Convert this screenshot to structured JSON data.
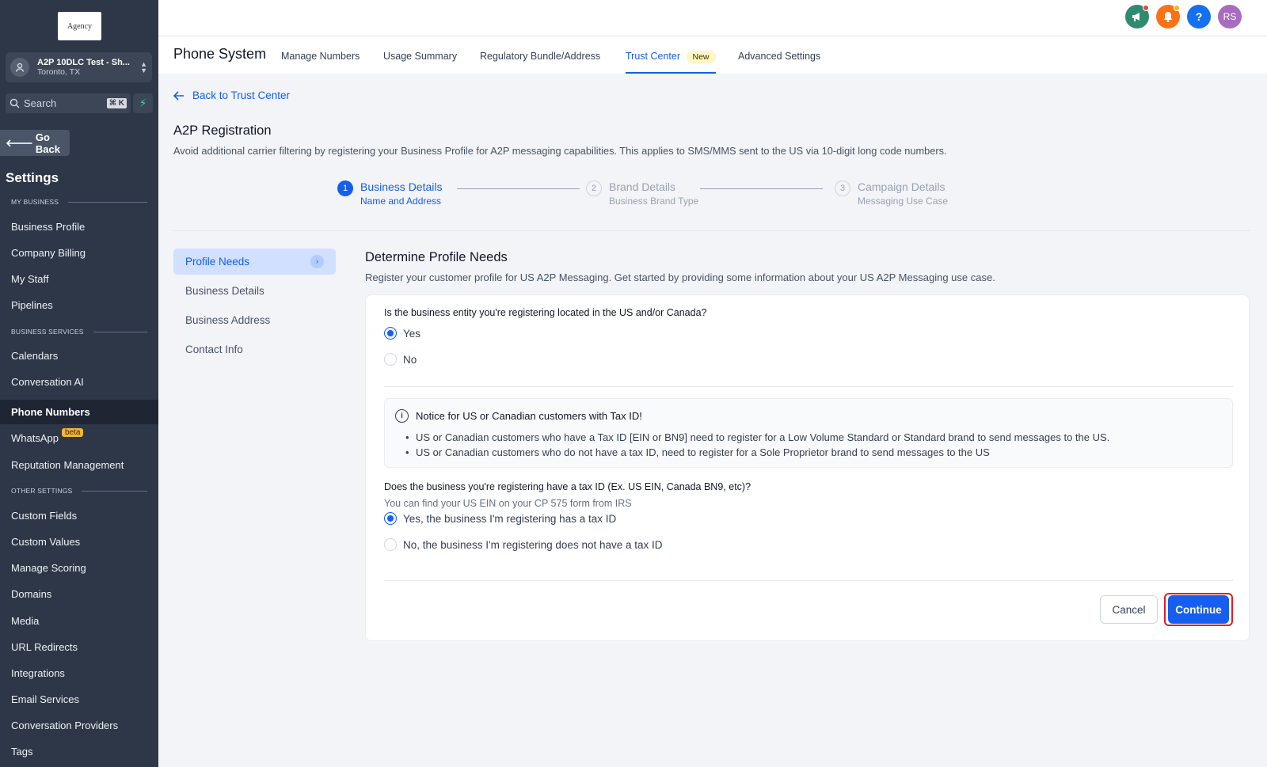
{
  "sidebar": {
    "logo_text": "Agency",
    "account": {
      "name": "A2P 10DLC Test - Sh...",
      "location": "Toronto, TX"
    },
    "search": {
      "placeholder": "Search",
      "shortcut": "⌘ K"
    },
    "go_back": "Go Back",
    "title": "Settings",
    "sections": [
      {
        "label": "MY BUSINESS",
        "items": [
          "Business Profile",
          "Company Billing",
          "My Staff",
          "Pipelines"
        ]
      },
      {
        "label": "BUSINESS SERVICES",
        "items": [
          "Calendars",
          "Conversation AI",
          "Phone Numbers",
          "WhatsApp",
          "Reputation Management"
        ]
      },
      {
        "label": "OTHER SETTINGS",
        "items": [
          "Custom Fields",
          "Custom Values",
          "Manage Scoring",
          "Domains",
          "Media",
          "URL Redirects",
          "Integrations",
          "Email Services",
          "Conversation Providers",
          "Tags"
        ]
      }
    ],
    "active_item": "Phone Numbers",
    "whatsapp_badge": "beta"
  },
  "header": {
    "avatar_initials": "RS",
    "icons": [
      "megaphone-icon",
      "bell-icon",
      "help-icon"
    ],
    "colors": {
      "megaphone": "#2e8b6f",
      "bell": "#f97316",
      "help": "#1570ef",
      "avatar": "#a86bbf"
    }
  },
  "tabs": {
    "app_title": "Phone System",
    "items": [
      "Manage Numbers",
      "Usage Summary",
      "Regulatory Bundle/Address",
      "Trust Center",
      "Advanced Settings"
    ],
    "active": "Trust Center",
    "new_badge": "New"
  },
  "page": {
    "back_link": "Back to Trust Center",
    "title": "A2P Registration",
    "subtitle": "Avoid additional carrier filtering by registering your Business Profile for A2P messaging capabilities. This applies to SMS/MMS sent to the US via 10-digit long code numbers."
  },
  "stepper": {
    "steps": [
      {
        "number": "1",
        "title": "Business Details",
        "subtitle": "Name and Address",
        "state": "active"
      },
      {
        "number": "2",
        "title": "Brand Details",
        "subtitle": "Business Brand Type",
        "state": "inactive"
      },
      {
        "number": "3",
        "title": "Campaign Details",
        "subtitle": "Messaging Use Case",
        "state": "inactive"
      }
    ]
  },
  "subnav": {
    "items": [
      "Profile Needs",
      "Business Details",
      "Business Address",
      "Contact Info"
    ],
    "active": "Profile Needs"
  },
  "form": {
    "title": "Determine Profile Needs",
    "subtitle": "Register your customer profile for US A2P Messaging. Get started by providing some information about your US A2P Messaging use case.",
    "q1": {
      "label": "Is the business entity you're registering located in the US and/or Canada?",
      "options": [
        "Yes",
        "No"
      ],
      "selected": "Yes"
    },
    "notice": {
      "title": "Notice for US or Canadian customers with Tax ID!",
      "bullets": [
        "US or Canadian customers who have a Tax ID [EIN or BN9] need to register for a Low Volume Standard or Standard brand to send messages to the US.",
        "US or Canadian customers who do not have a tax ID, need to register for a Sole Proprietor brand to send messages to the US"
      ]
    },
    "q2": {
      "label": "Does the business you're registering have a tax ID (Ex. US EIN, Canada BN9, etc)?",
      "hint": "You can find your US EIN on your CP 575 form from IRS",
      "options": [
        "Yes, the business I'm registering has a tax ID",
        "No, the business I'm registering does not have a tax ID"
      ],
      "selected": "Yes, the business I'm registering has a tax ID"
    },
    "cancel_label": "Cancel",
    "continue_label": "Continue"
  }
}
